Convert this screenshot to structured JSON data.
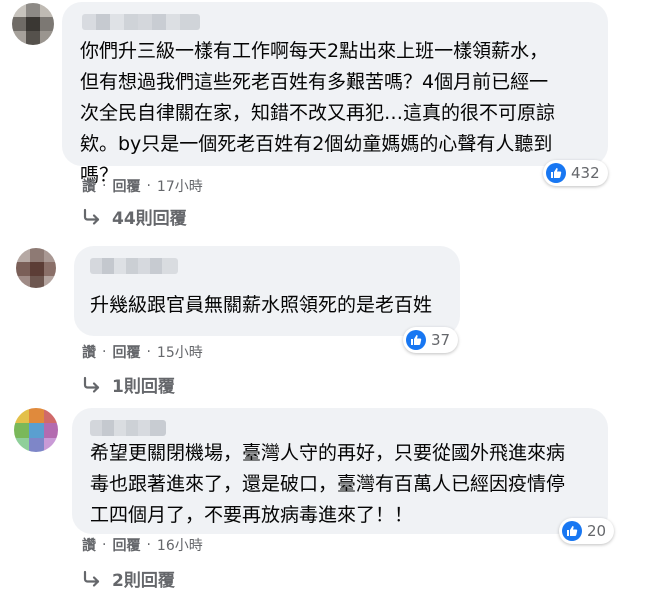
{
  "comments": [
    {
      "text": "你們升三級一樣有工作啊每天2點出來上班一樣領薪水，\n但有想過我們這些死老百姓有多艱苦嗎？4個月前已經一\n次全民自律關在家，知錯不改又再犯…這真的很不可原諒\n欸。by只是一個死老百姓有2個幼童媽媽的心聲有人聽到\n嗎？",
      "reactions": "432",
      "like": "讚",
      "reply": "回覆",
      "time": "17小時",
      "replies_label": "44則回覆"
    },
    {
      "text": "升幾級跟官員無關薪水照領死的是老百姓",
      "reactions": "37",
      "like": "讚",
      "reply": "回覆",
      "time": "15小時",
      "replies_label": "1則回覆"
    },
    {
      "text": "希望更關閉機場，臺灣人守的再好，只要從國外飛進來病\n毒也跟著進來了，還是破口，臺灣有百萬人已經因疫情停\n工四個月了，不要再放病毒進來了！！",
      "reactions": "20",
      "like": "讚",
      "reply": "回覆",
      "time": "16小時",
      "replies_label": "2則回覆"
    }
  ],
  "separator": "·",
  "icons": {
    "like": "thumbs-up-icon",
    "reply_arrow": "reply-arrow-icon"
  },
  "colors": {
    "bubble": "#f0f2f5",
    "secondary_text": "#65676b",
    "like_blue": "#1877f2"
  }
}
